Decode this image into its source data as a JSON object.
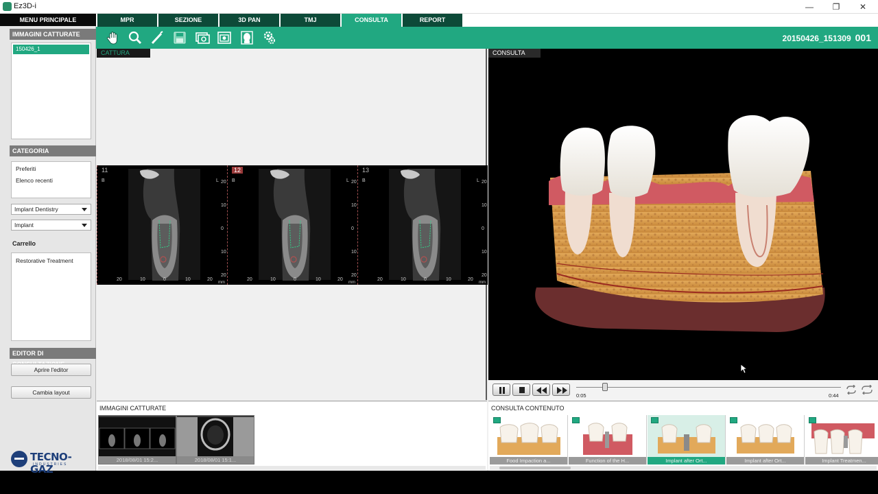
{
  "window": {
    "title": "Ez3D-i",
    "minimize": "—",
    "restore": "❐",
    "close": "✕"
  },
  "left": {
    "menu_label": "MENU PRINCIPALE",
    "captured_header": "IMMAGINI CATTURATE",
    "captured_items": [
      "150426_1"
    ],
    "category_header": "CATEGORIA",
    "category_items": [
      "Preferiti",
      "Elenco recenti"
    ],
    "dropdown1": "Implant Dentistry",
    "dropdown2": "Implant",
    "cart_header": "Carrello",
    "cart_items": [
      "Restorative Treatment"
    ],
    "editor_header": "EDITOR DI CONSULTAZIONE",
    "open_editor": "Aprire l'editor",
    "change_layout": "Cambia layout",
    "logo_text": "TECNO-GAZ",
    "logo_sub": "INDUSTRIES"
  },
  "tabs": [
    "MPR",
    "SEZIONE",
    "3D PAN",
    "TMJ",
    "CONSULTA",
    "REPORT"
  ],
  "active_tab": "CONSULTA",
  "patient": {
    "id": "20150426_151309",
    "number": "001"
  },
  "toolbar_icons": [
    "hand-icon",
    "zoom-icon",
    "pen-icon",
    "save-icon",
    "capture-icon",
    "camera-icon",
    "face-icon",
    "settings-icon"
  ],
  "capture_pane": {
    "label": "CATTURA",
    "slices": [
      {
        "num": "11",
        "highlight": false
      },
      {
        "num": "12",
        "highlight": true
      },
      {
        "num": "13",
        "highlight": false
      }
    ],
    "scale_right": [
      "20",
      "10",
      "0",
      "10",
      "20"
    ],
    "scale_bottom": [
      "20",
      "10",
      "0",
      "10",
      "20"
    ],
    "unit": "mm",
    "marker_b": "B",
    "marker_l": "L"
  },
  "consult_pane": {
    "label": "CONSULTA"
  },
  "player": {
    "current": "0:05",
    "total": "0:44",
    "progress": 0.11
  },
  "captured_strip": {
    "label": "IMMAGINI CATTURATE",
    "thumbs": [
      "2018/08/01 15:2...",
      "2018/08/01 15:1..."
    ]
  },
  "content_strip": {
    "label": "CONSULTA CONTENUTO",
    "items": [
      "Food Impaction a...",
      "Function of the H...",
      "Implant after Ort...",
      "Implant after Ort...",
      "Implant Treatmen..."
    ],
    "selected_index": 2
  },
  "colors": {
    "accent": "#21a881",
    "dark_tab": "#0d4a38",
    "brand": "#1e3f7a"
  }
}
